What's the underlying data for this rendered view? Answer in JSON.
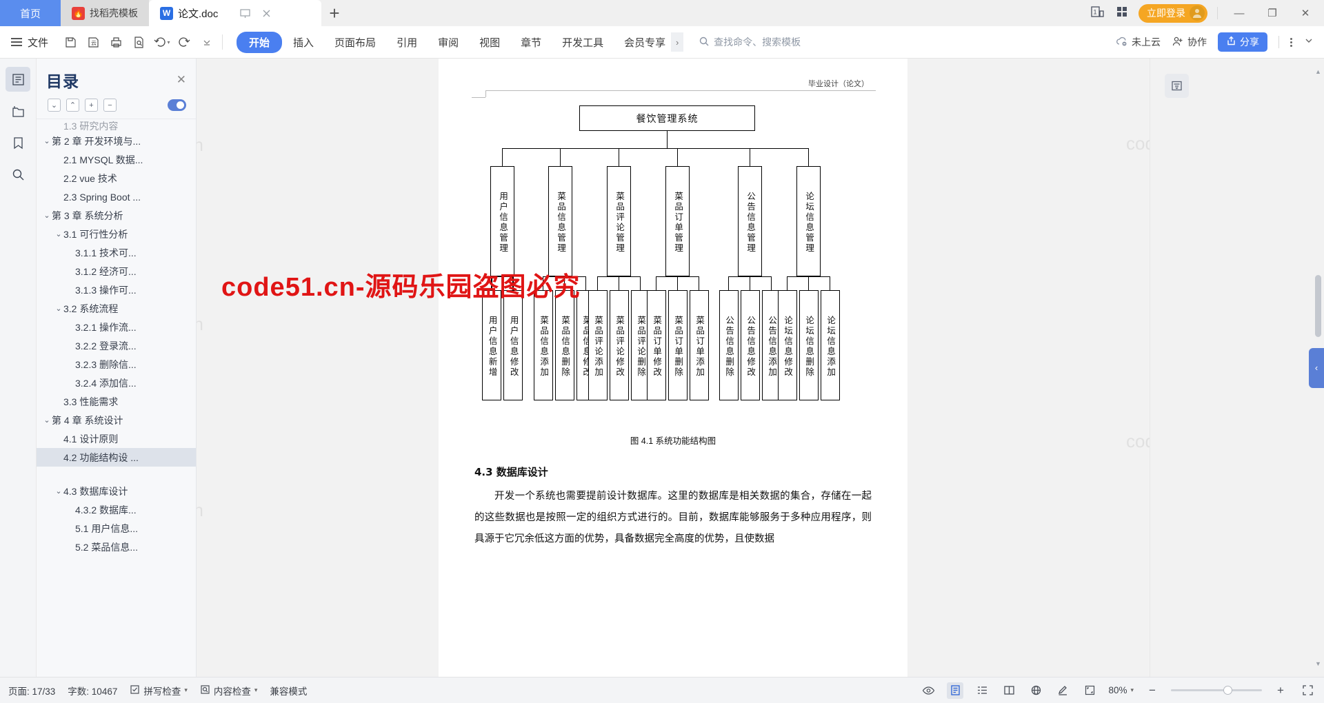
{
  "window": {
    "tabs": [
      {
        "label": "首页",
        "type": "home"
      },
      {
        "label": "找稻壳模板",
        "type": "template",
        "icon": "flame-icon"
      },
      {
        "label": "论文.doc",
        "type": "document",
        "icon": "wps-writer-icon"
      }
    ],
    "new_tab_label": "+",
    "login_label": "立即登录",
    "minimize": "—",
    "restore": "❐",
    "close": "✕"
  },
  "ribbon": {
    "file_label": "文件",
    "tabs": [
      {
        "label": "开始",
        "active": true
      },
      {
        "label": "插入",
        "active": false
      },
      {
        "label": "页面布局",
        "active": false
      },
      {
        "label": "引用",
        "active": false
      },
      {
        "label": "审阅",
        "active": false
      },
      {
        "label": "视图",
        "active": false
      },
      {
        "label": "章节",
        "active": false
      },
      {
        "label": "开发工具",
        "active": false
      },
      {
        "label": "会员专享",
        "active": false
      }
    ],
    "search_placeholder": "查找命令、搜索模板",
    "cloud_status": "未上云",
    "collaborate": "协作",
    "share": "分享"
  },
  "outline": {
    "title": "目录",
    "tools": [
      "collapse-down",
      "collapse-up",
      "expand-all",
      "collapse-all"
    ],
    "items": [
      {
        "label": "1.3 研究内容",
        "level": 2,
        "caret": "",
        "partial": true
      },
      {
        "label": "第 2 章  开发环境与...",
        "level": 1,
        "caret": "⌄"
      },
      {
        "label": "2.1 MYSQL 数据...",
        "level": 2,
        "caret": ""
      },
      {
        "label": "2.2 vue 技术",
        "level": 2,
        "caret": ""
      },
      {
        "label": "2.3 Spring Boot ...",
        "level": 2,
        "caret": ""
      },
      {
        "label": "第 3 章  系统分析",
        "level": 1,
        "caret": "⌄"
      },
      {
        "label": "3.1 可行性分析",
        "level": 2,
        "caret": "⌄"
      },
      {
        "label": "3.1.1 技术可...",
        "level": 3,
        "caret": ""
      },
      {
        "label": "3.1.2 经济可...",
        "level": 3,
        "caret": ""
      },
      {
        "label": "3.1.3 操作可...",
        "level": 3,
        "caret": ""
      },
      {
        "label": "3.2 系统流程",
        "level": 2,
        "caret": "⌄"
      },
      {
        "label": "3.2.1 操作流...",
        "level": 3,
        "caret": ""
      },
      {
        "label": "3.2.2 登录流...",
        "level": 3,
        "caret": ""
      },
      {
        "label": "3.2.3 删除信...",
        "level": 3,
        "caret": ""
      },
      {
        "label": "3.2.4 添加信...",
        "level": 3,
        "caret": ""
      },
      {
        "label": "3.3 性能需求",
        "level": 2,
        "caret": ""
      },
      {
        "label": "第 4 章  系统设计",
        "level": 1,
        "caret": "⌄"
      },
      {
        "label": "4.1 设计原则",
        "level": 2,
        "caret": ""
      },
      {
        "label": "4.2 功能结构设 ...",
        "level": 2,
        "caret": "",
        "selected": true
      },
      {
        "label": "",
        "level": 2,
        "caret": "",
        "spacer": true
      },
      {
        "label": "4.3 数据库设计",
        "level": 2,
        "caret": "⌄"
      },
      {
        "label": "4.3.2 数据库...",
        "level": 3,
        "caret": ""
      },
      {
        "label": "5.1 用户信息...",
        "level": 3,
        "caret": ""
      },
      {
        "label": "5.2 菜品信息...",
        "level": 3,
        "caret": ""
      }
    ]
  },
  "document": {
    "header_text": "毕业设计（论文）",
    "figure_caption": "图 4.1  系统功能结构图",
    "section_heading": "4.3  数据库设计",
    "paragraphs": [
      "开发一个系统也需要提前设计数据库。这里的数据库是相关数据的集合，存储在一起的这些数据也是按照一定的组织方式进行的。目前，数据库能够服务于多种应用程序，则具源于它冗余低这方面的优势，具备数据完全高度的优势，且使数据"
    ],
    "watermarks": [
      "code51.cn"
    ],
    "red_watermark": "code51.cn-源码乐园盗图必究"
  },
  "chart_data": {
    "type": "diagram",
    "title": "餐饮管理系统",
    "figure_label": "图 4.1  系统功能结构图",
    "root": "餐饮管理系统",
    "level2": [
      "用户信息管理",
      "菜品信息管理",
      "菜品评论管理",
      "菜品订单管理",
      "公告信息管理",
      "论坛信息管理"
    ],
    "level3": [
      {
        "parent": "用户信息管理",
        "children": [
          "用户信息新增",
          "用户信息修改"
        ]
      },
      {
        "parent": "菜品信息管理",
        "children": [
          "菜品信息添加",
          "菜品信息删除",
          "菜品信息修改"
        ]
      },
      {
        "parent": "菜品评论管理",
        "children": [
          "菜品评论添加",
          "菜品评论修改",
          "菜品评论删除"
        ]
      },
      {
        "parent": "菜品订单管理",
        "children": [
          "菜品订单修改",
          "菜品订单删除",
          "菜品订单添加"
        ]
      },
      {
        "parent": "公告信息管理",
        "children": [
          "公告信息删除",
          "公告信息修改",
          "公告信息添加"
        ]
      },
      {
        "parent": "论坛信息管理",
        "children": [
          "论坛信息修改",
          "论坛信息删除",
          "论坛信息添加"
        ]
      }
    ]
  },
  "statusbar": {
    "page": "页面: 17/33",
    "words": "字数: 10467",
    "spellcheck": "拼写检查",
    "contentcheck": "内容检查",
    "compat": "兼容模式",
    "zoom": "80%",
    "zoom_out": "−",
    "zoom_in": "+"
  },
  "colors": {
    "accent": "#4a7ff0",
    "home_tab": "#5a8dee",
    "login": "#f5a623",
    "outline_title": "#1f3864",
    "red_watermark": "#e01515"
  }
}
